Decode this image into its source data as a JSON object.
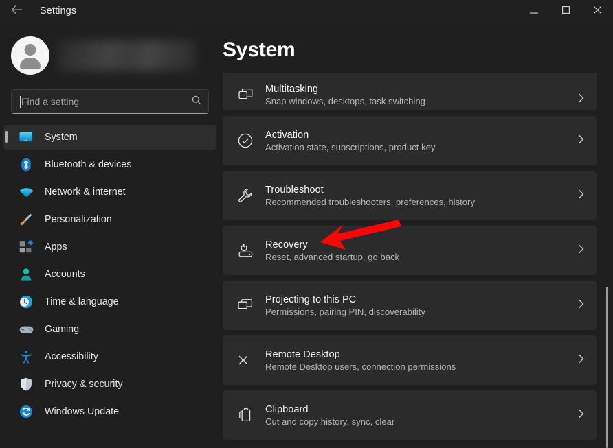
{
  "titlebar": {
    "back_icon": "back-arrow-icon",
    "title": "Settings",
    "minimize_label": "—",
    "maximize_label": "□",
    "close_label": "✕"
  },
  "account": {
    "avatar_icon": "person-avatar-icon",
    "name_blurred": ""
  },
  "search": {
    "placeholder": "Find a setting",
    "value": "",
    "icon": "search-icon"
  },
  "sidebar": {
    "items": [
      {
        "label": "System",
        "icon": "monitor-icon",
        "selected": true
      },
      {
        "label": "Bluetooth & devices",
        "icon": "bluetooth-icon",
        "selected": false
      },
      {
        "label": "Network & internet",
        "icon": "wifi-icon",
        "selected": false
      },
      {
        "label": "Personalization",
        "icon": "paintbrush-icon",
        "selected": false
      },
      {
        "label": "Apps",
        "icon": "apps-icon",
        "selected": false
      },
      {
        "label": "Accounts",
        "icon": "account-person-icon",
        "selected": false
      },
      {
        "label": "Time & language",
        "icon": "clock-globe-icon",
        "selected": false
      },
      {
        "label": "Gaming",
        "icon": "gamepad-icon",
        "selected": false
      },
      {
        "label": "Accessibility",
        "icon": "accessibility-person-icon",
        "selected": false
      },
      {
        "label": "Privacy & security",
        "icon": "shield-icon",
        "selected": false
      },
      {
        "label": "Windows Update",
        "icon": "update-refresh-icon",
        "selected": false
      }
    ]
  },
  "main": {
    "page_title": "System",
    "cards": [
      {
        "title": "Multitasking",
        "subtitle": "Snap windows, desktops, task switching",
        "icon": "windows-stack-icon",
        "clipped": true
      },
      {
        "title": "Activation",
        "subtitle": "Activation state, subscriptions, product key",
        "icon": "check-circle-icon",
        "clipped": false
      },
      {
        "title": "Troubleshoot",
        "subtitle": "Recommended troubleshooters, preferences, history",
        "icon": "wrench-icon",
        "clipped": false
      },
      {
        "title": "Recovery",
        "subtitle": "Reset, advanced startup, go back",
        "icon": "recovery-reset-icon",
        "clipped": false
      },
      {
        "title": "Projecting to this PC",
        "subtitle": "Permissions, pairing PIN, discoverability",
        "icon": "project-screen-icon",
        "clipped": false
      },
      {
        "title": "Remote Desktop",
        "subtitle": "Remote Desktop users, connection permissions",
        "icon": "remote-desktop-icon",
        "clipped": false
      },
      {
        "title": "Clipboard",
        "subtitle": "Cut and copy history, sync, clear",
        "icon": "clipboard-icon",
        "clipped": false
      }
    ],
    "chevron_icon": "chevron-right-icon"
  },
  "annotation": {
    "arrow_color": "#fb0606",
    "points_to": "Recovery"
  },
  "colors": {
    "page_background": "#1f1f1f",
    "card_background": "#2b2b2b",
    "titlebar_background": "#202020",
    "selected_nav_background": "#2d2d2d",
    "accent_indicator": "#b0b0b0",
    "annotation_red": "#fb0606"
  }
}
